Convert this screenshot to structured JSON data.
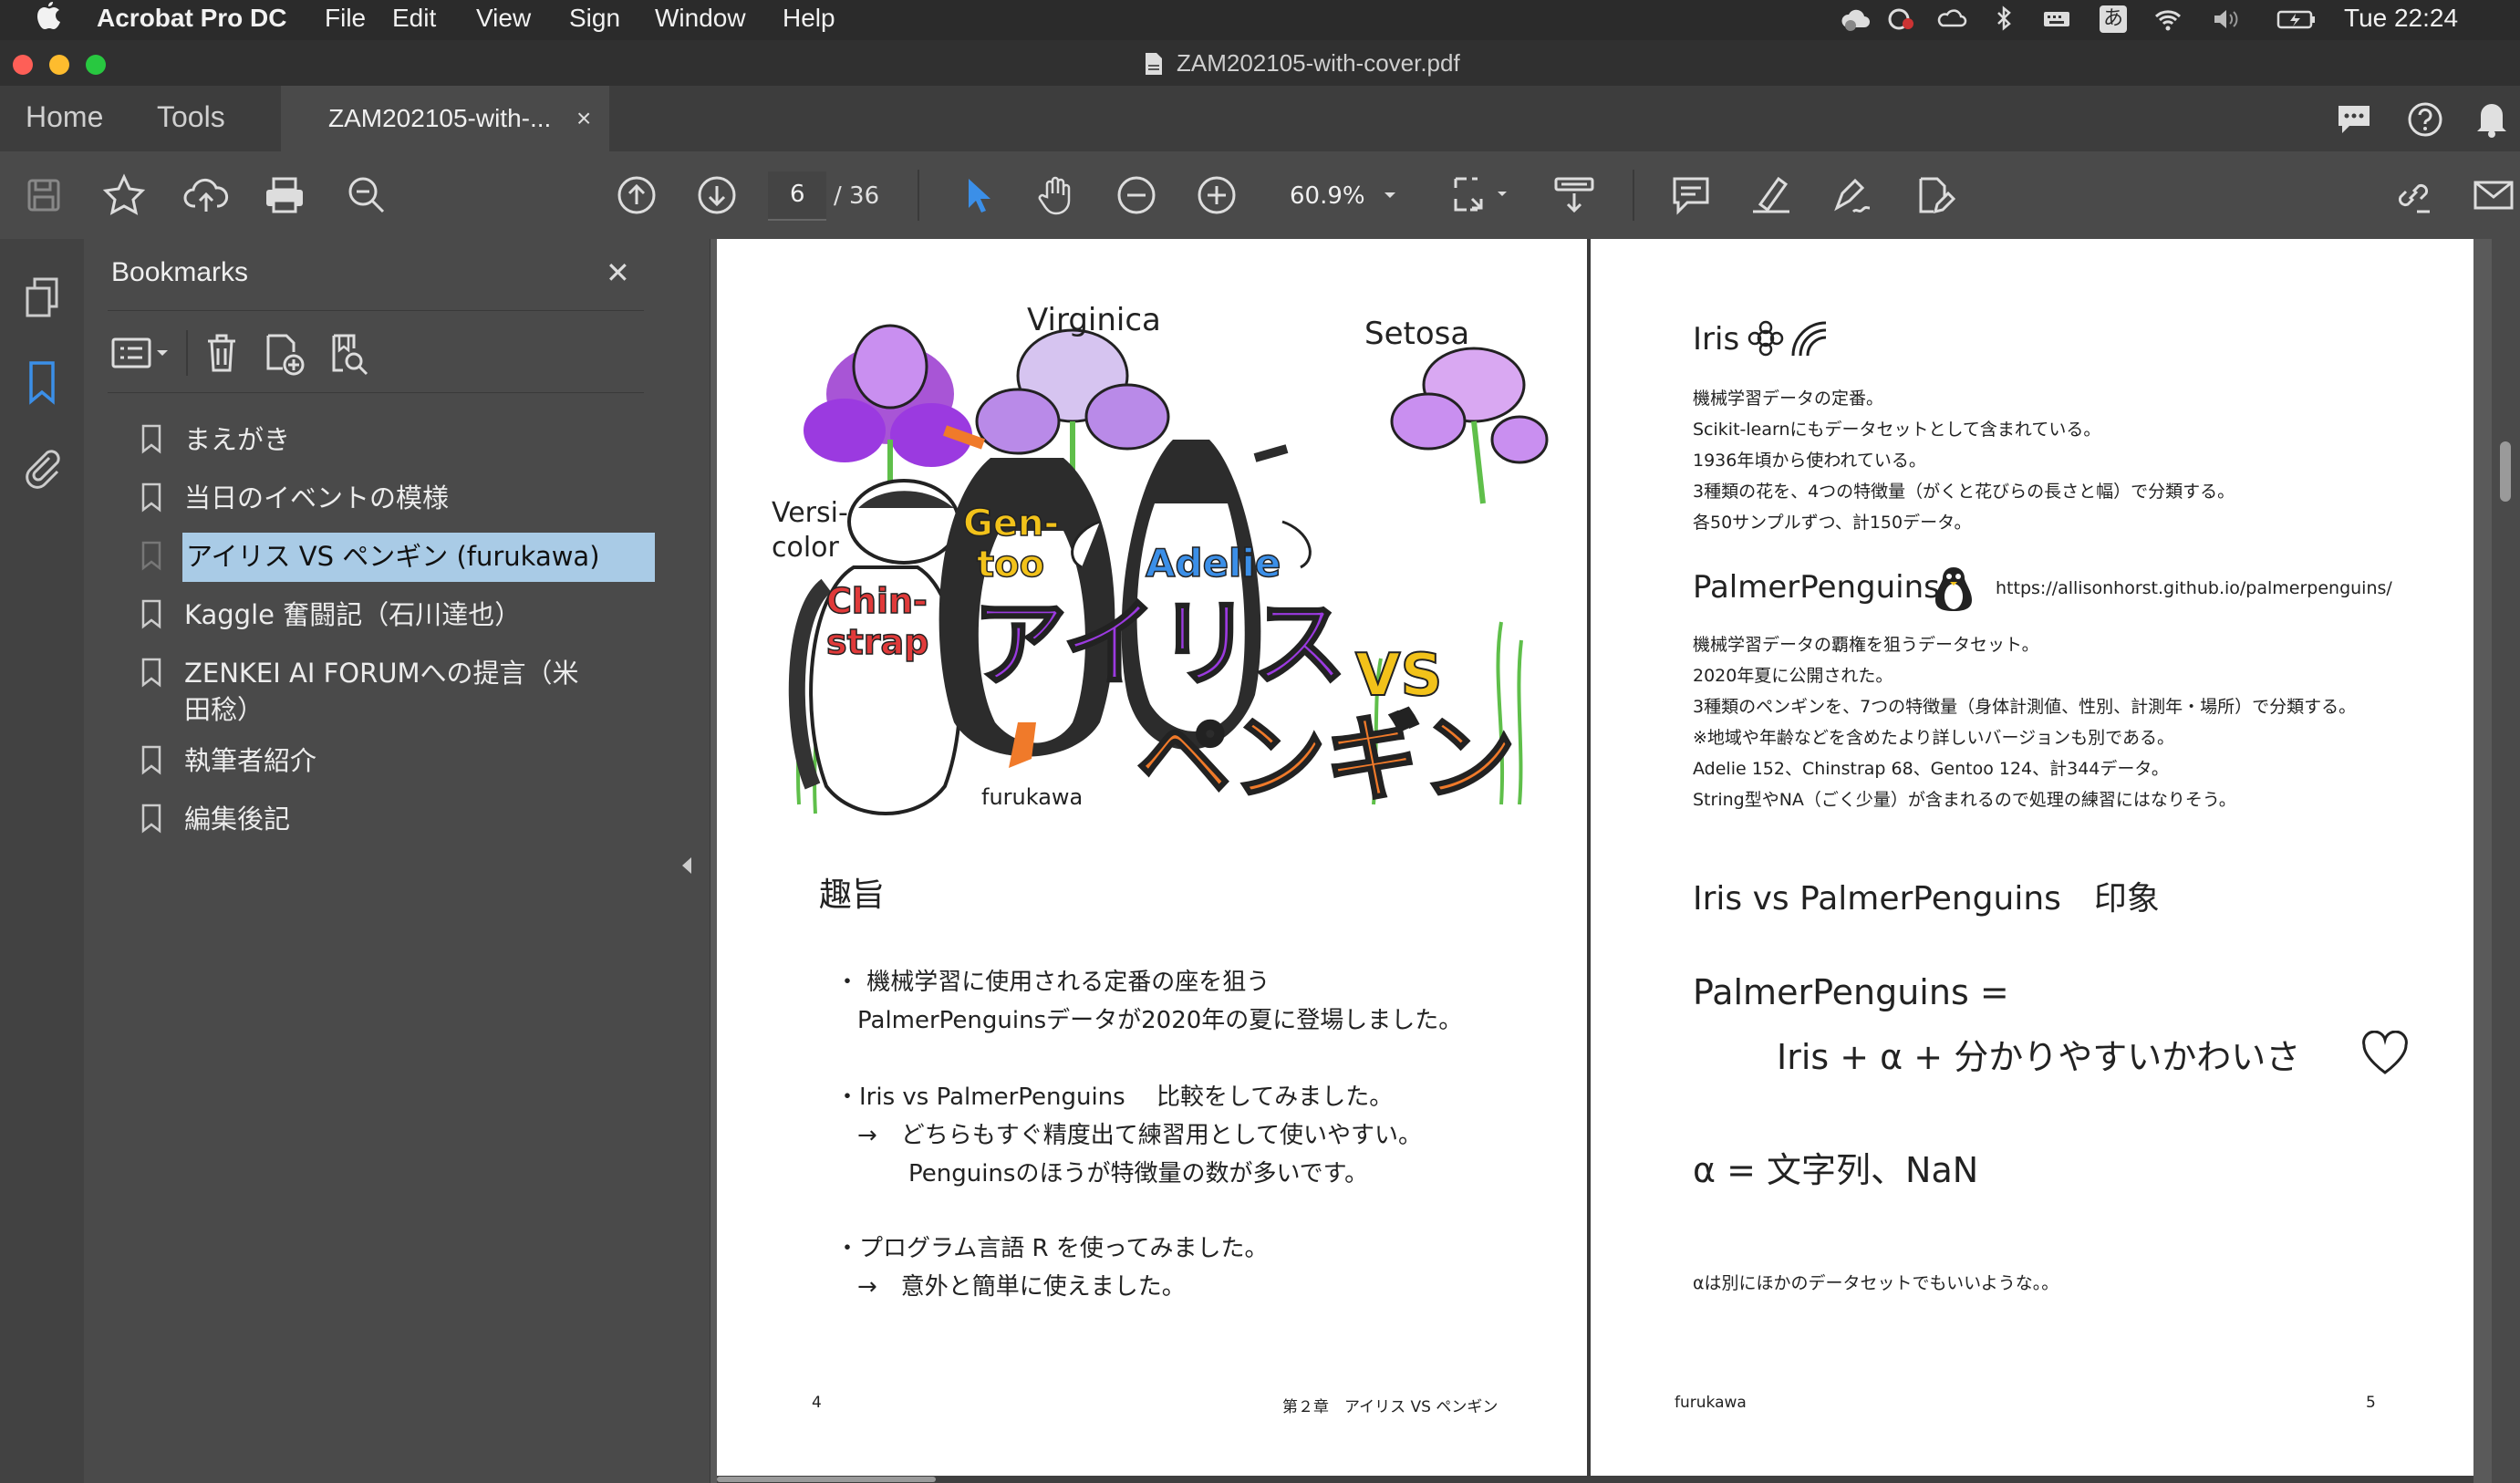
{
  "menubar": {
    "app": "Acrobat Pro DC",
    "items": [
      "File",
      "Edit",
      "View",
      "Sign",
      "Window",
      "Help"
    ],
    "clock": "Tue 22:24",
    "input_method": "あ"
  },
  "window": {
    "title": "ZAM202105-with-cover.pdf"
  },
  "tabs": {
    "home": "Home",
    "tools": "Tools",
    "doc": "ZAM202105-with-...",
    "close": "×"
  },
  "toolbar": {
    "page_current": "6",
    "page_total": "/ 36",
    "zoom": "60.9%"
  },
  "bookmarks": {
    "title": "Bookmarks",
    "close": "✕",
    "items": [
      "まえがき",
      "当日のイベントの模様",
      "アイリス VS ペンギン (furukawa)",
      "Kaggle 奮闘記（石川達也）",
      "ZENKEI AI FORUMへの提言（米",
      "田稔）",
      "執筆者紹介",
      "編集後記"
    ]
  },
  "left_page": {
    "art_labels": {
      "virginica": "Virginica",
      "setosa": "Setosa",
      "versi": "Versi-",
      "color": "color",
      "gen": "Gen-",
      "too": "too",
      "adelie": "Adelie",
      "chin": "Chin-",
      "strap": "strap",
      "title_jp": "アイリス",
      "vs": "VS",
      "penguin_jp": "ペンギン",
      "author": "furukawa"
    },
    "heading": "趣旨",
    "lines": [
      "・ 機械学習に使用される定番の座を狙う",
      "PalmerPenguinsデータが2020年の夏に登場しました。",
      "・Iris vs PalmerPenguins　 比較をしてみました。",
      "→　どちらもすぐ精度出て練習用として使いやすい。",
      "Penguinsのほうが特徴量の数が多いです。",
      "・プログラム言語 R を使ってみました。",
      "→　意外と簡単に使えました。"
    ],
    "footer_page": "4",
    "footer_chapter": "第２章　アイリス VS ペンギン"
  },
  "right_page": {
    "iris_heading": "Iris",
    "iris_lines": [
      "機械学習データの定番。",
      "Scikit-learnにもデータセットとして含まれている。",
      "1936年頃から使われている。",
      "3種類の花を、4つの特徴量（がくと花びらの長さと幅）で分類する。",
      "各50サンプルずつ、計150データ。"
    ],
    "pp_heading": "PalmerPenguins",
    "pp_url": "https://allisonhorst.github.io/palmerpenguins/",
    "pp_lines": [
      "機械学習データの覇権を狙うデータセット。",
      "2020年夏に公開された。",
      "3種類のペンギンを、7つの特徴量（身体計測値、性別、計測年・場所）で分類する。",
      "※地域や年齢などを含めたより詳しいバージョンも別である。",
      "Adelie 152、Chinstrap 68、Gentoo 124、計344データ。",
      "String型やNA（ごく少量）が含まれるので処理の練習にはなりそう。"
    ],
    "impression": "Iris vs PalmerPenguins　印象",
    "formula1": "PalmerPenguins =",
    "formula2": "Iris + α + 分かりやすいかわいさ",
    "formula3": "α = 文字列、NaN",
    "note": "αは別にほかのデータセットでもいいような。。",
    "footer_author": "furukawa",
    "footer_page": "5"
  },
  "colors": {
    "highlight": "#a9cbe6",
    "accent_blue": "#3b8fe8",
    "purple": "#9b3ae0",
    "orange": "#f07a2a"
  }
}
